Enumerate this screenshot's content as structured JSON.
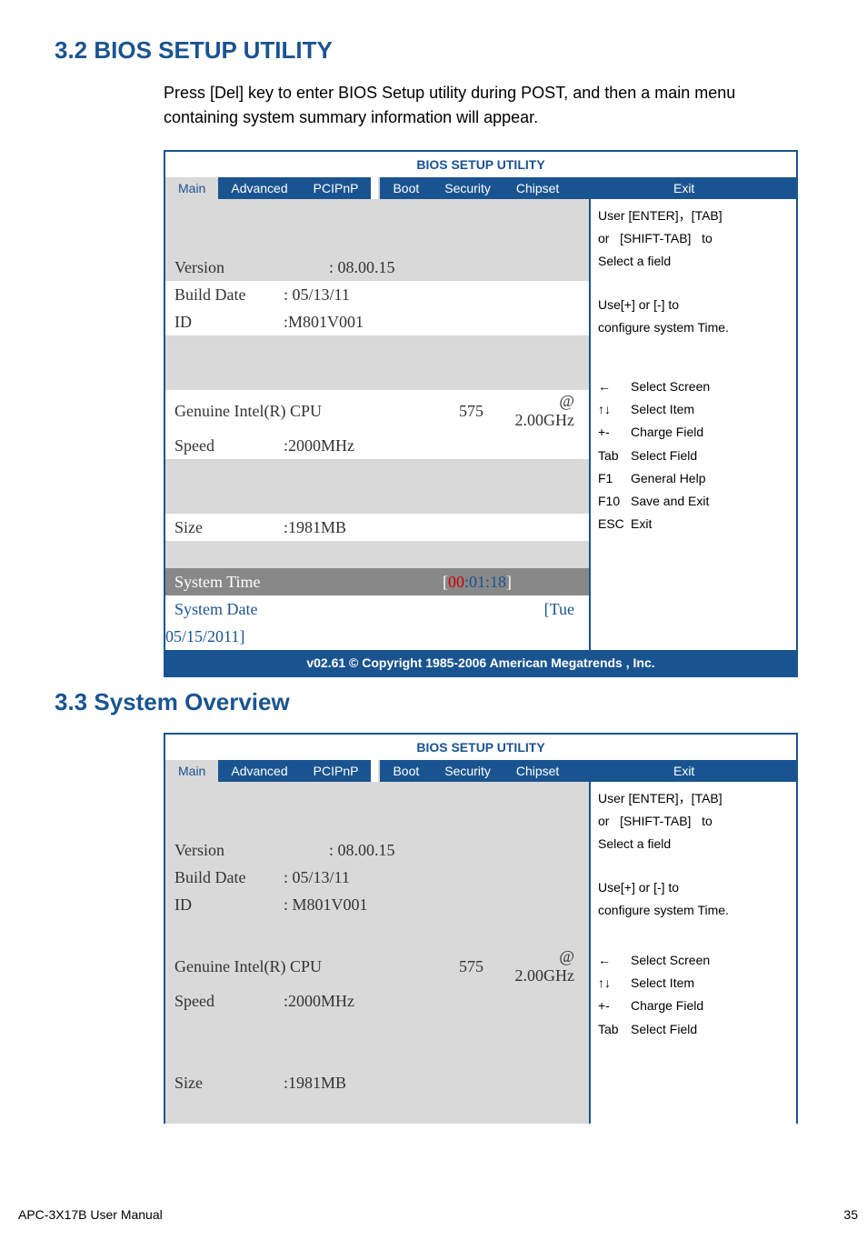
{
  "headings": {
    "h32": "3.2   BIOS SETUP UTILITY",
    "h33": "3.3   System Overview",
    "intro": "Press [Del] key to enter BIOS Setup utility during POST, and then a main menu containing system summary information will appear."
  },
  "bios_title": "BIOS SETUP UTILITY",
  "tabs": [
    "Main",
    "Advanced",
    "PCIPnP",
    "Boot",
    "Security",
    "Chipset",
    "Exit"
  ],
  "main_panel": {
    "version_label": "Version",
    "version_value": ": 08.00.15",
    "build_label": "Build Date",
    "build_value": ": 05/13/11",
    "id_label": "ID",
    "id_value": ":M801V001",
    "cpu_label": "Genuine Intel(R) CPU",
    "cpu_mid": "575",
    "cpu_val": "@ 2.00GHz",
    "speed_label": "Speed",
    "speed_value": ":2000MHz",
    "size_label": "Size",
    "size_value": ":1981MB",
    "systime_label": "System Time",
    "systime_hr": "00",
    "systime_mn": "01",
    "systime_sc": "18",
    "sysdate_label": "System   Date",
    "sysdate_day": "[Tue",
    "sysdate_date": "05/15/2011]"
  },
  "help": {
    "line1": "User [ENTER]，[TAB]",
    "line2a": "or",
    "line2b": "[SHIFT-TAB]",
    "line2c": "to",
    "line3": "Select a field",
    "line4": "Use[+] or [-] to",
    "line5": "configure system Time.",
    "items": [
      {
        "key": "←",
        "label": "Select Screen"
      },
      {
        "key": "↑↓",
        "label": "Select Item"
      },
      {
        "key": "+-",
        "label": "Charge Field"
      },
      {
        "key": "Tab",
        "label": "Select Field"
      },
      {
        "key": "F1",
        "label": "General Help"
      },
      {
        "key": "F10",
        "label": "Save and Exit"
      },
      {
        "key": "ESC",
        "label": "Exit"
      }
    ]
  },
  "footer": "v02.61 © Copyright 1985-2006 American Megatrends , Inc.",
  "page_footer_left": "APC-3X17B User Manual",
  "page_footer_right": "35"
}
